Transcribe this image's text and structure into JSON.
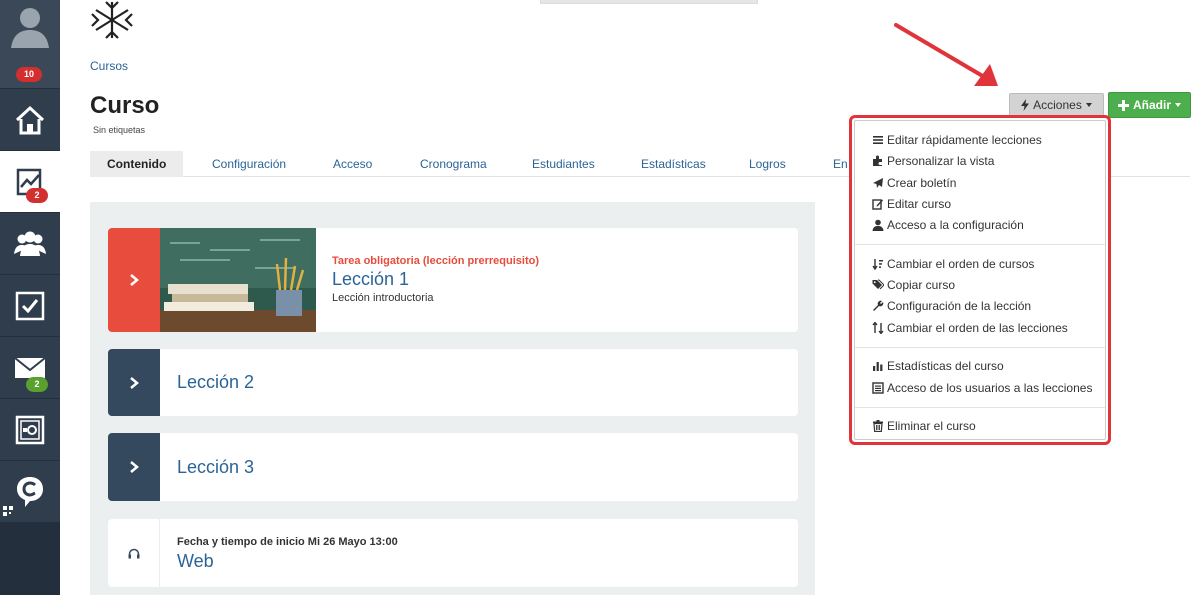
{
  "sidebar": {
    "profile_badge": "10",
    "items": [
      {
        "icon": "home-icon"
      },
      {
        "icon": "chart-icon",
        "badge": "2"
      },
      {
        "icon": "users-icon"
      },
      {
        "icon": "checkbox-icon"
      },
      {
        "icon": "mail-icon",
        "badge": "2"
      },
      {
        "icon": "safe-icon"
      },
      {
        "icon": "chat-c-icon"
      }
    ]
  },
  "header": {
    "breadcrumb": "Cursos",
    "title": "Curso",
    "tags": "Sin etiquetas",
    "actions_label": "Acciones",
    "add_label": "Añadir"
  },
  "tabs": [
    "Contenido",
    "Configuración",
    "Acceso",
    "Cronograma",
    "Estudiantes",
    "Estadísticas",
    "Logros",
    "En"
  ],
  "lessons": {
    "l1": {
      "requirement": "Tarea obligatoria (lección prerrequisito)",
      "title": "Lección 1",
      "subtitle": "Lección introductoria"
    },
    "l2": {
      "title": "Lección 2"
    },
    "l3": {
      "title": "Lección 3"
    },
    "web": {
      "meta": "Fecha y tiempo de inicio Mi 26 Mayo 13:00",
      "title": "Web"
    }
  },
  "actions_menu": [
    "Editar rápidamente lecciones",
    "Personalizar la vista",
    "Crear boletín",
    "Editar curso",
    "Acceso a la configuración",
    "Cambiar el orden de cursos",
    "Copiar curso",
    "Configuración de la lección",
    "Cambiar el orden de las lecciones",
    "Estadísticas del curso",
    "Acceso de los usuarios a las lecciones",
    "Eliminar el curso"
  ],
  "colors": {
    "sidebar": "#2f3d4c",
    "accent_red": "#e74c3c",
    "navy": "#34495e",
    "link": "#2a6496",
    "success": "#4cae4c",
    "highlight": "#e0333a"
  }
}
